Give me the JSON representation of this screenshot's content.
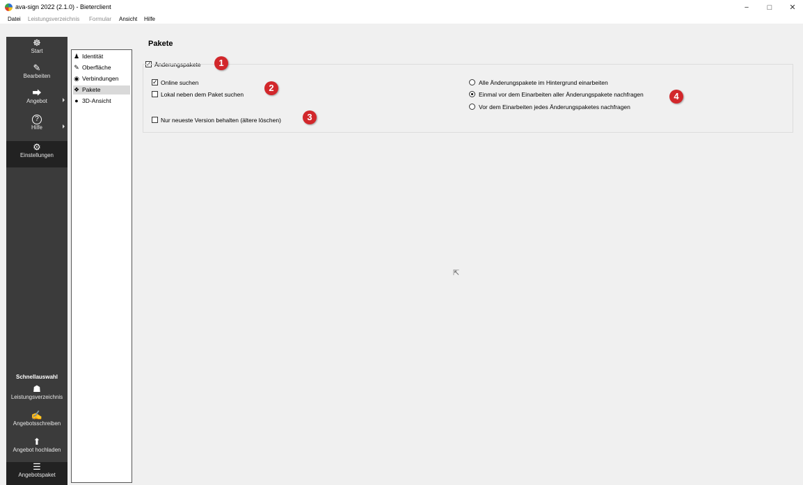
{
  "window": {
    "title": "ava-sign 2022 (2.1.0) - Bieterclient",
    "minimize": "−",
    "maximize": "□",
    "close": "✕"
  },
  "menu": [
    "Datei",
    "Leistungsverzeichnis",
    "Formular",
    "Ansicht",
    "Hilfe"
  ],
  "sidebar": {
    "items": [
      {
        "label": "Start",
        "icon": "ship-wheel-icon",
        "glyph": "☸"
      },
      {
        "label": "Bearbeiten",
        "icon": "pencil-icon",
        "glyph": "✎"
      },
      {
        "label": "Angebot",
        "icon": "share-icon",
        "glyph": "⮕"
      },
      {
        "label": "Hilfe",
        "icon": "help-icon",
        "glyph": "?"
      },
      {
        "label": "Einstellungen",
        "icon": "gear-icon",
        "glyph": "⚙"
      }
    ],
    "quick_title": "Schnellauswahl",
    "quick_items": [
      {
        "label": "Leistungsverzeichnis",
        "icon": "coins-icon",
        "glyph": "☗"
      },
      {
        "label": "Angebotsschreiben",
        "icon": "edit-document-icon",
        "glyph": "✍"
      },
      {
        "label": "Angebot hochladen",
        "icon": "upload-icon",
        "glyph": "⬆"
      },
      {
        "label": "Angebotspaket",
        "icon": "package-list-icon",
        "glyph": "☰"
      }
    ]
  },
  "tree": {
    "items": [
      "Identität",
      "Oberfläche",
      "Verbindungen",
      "Pakete",
      "3D-Ansicht"
    ],
    "selected": "Pakete"
  },
  "page": {
    "title": "Pakete",
    "group_checkbox": "Änderungspakete",
    "online": "Online suchen",
    "local": "Lokal neben dem Paket suchen",
    "newest": "Nur neueste Version behalten (ältere löschen)",
    "radio1": "Alle Änderungspakete im Hintergrund einarbeiten",
    "radio2": "Einmal vor dem Einarbeiten aller Änderungspakete nachfragen",
    "radio3": "Vor dem Einarbeiten jedes Änderungspaketes nachfragen"
  },
  "badges": [
    "1",
    "2",
    "3",
    "4"
  ]
}
